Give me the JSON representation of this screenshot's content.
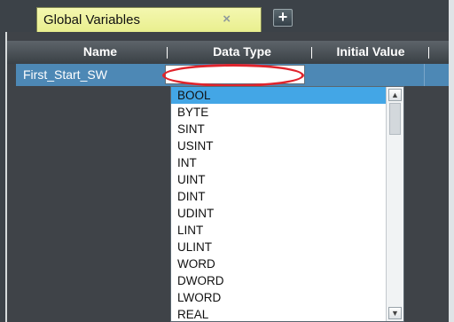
{
  "tab": {
    "title": "Global Variables",
    "close_glyph": "×",
    "add_glyph": "+"
  },
  "table": {
    "headers": [
      "Name",
      "Data Type",
      "Initial Value"
    ],
    "row": {
      "name": "First_Start_SW",
      "data_type": "",
      "initial_value": ""
    }
  },
  "dropdown": {
    "selected_option": "BOOL",
    "options": [
      "BOOL",
      "BYTE",
      "SINT",
      "USINT",
      "INT",
      "UINT",
      "DINT",
      "UDINT",
      "LINT",
      "ULINT",
      "WORD",
      "DWORD",
      "LWORD",
      "REAL"
    ]
  },
  "icons": {
    "close": "close-icon",
    "add": "plus-icon",
    "scroll_up": "chevron-up-icon",
    "scroll_down": "chevron-down-icon"
  },
  "colors": {
    "selection": "#43a6e6",
    "row_highlight": "#4d88b5",
    "annotation": "#e0242c",
    "tab": "#eef2a0"
  }
}
